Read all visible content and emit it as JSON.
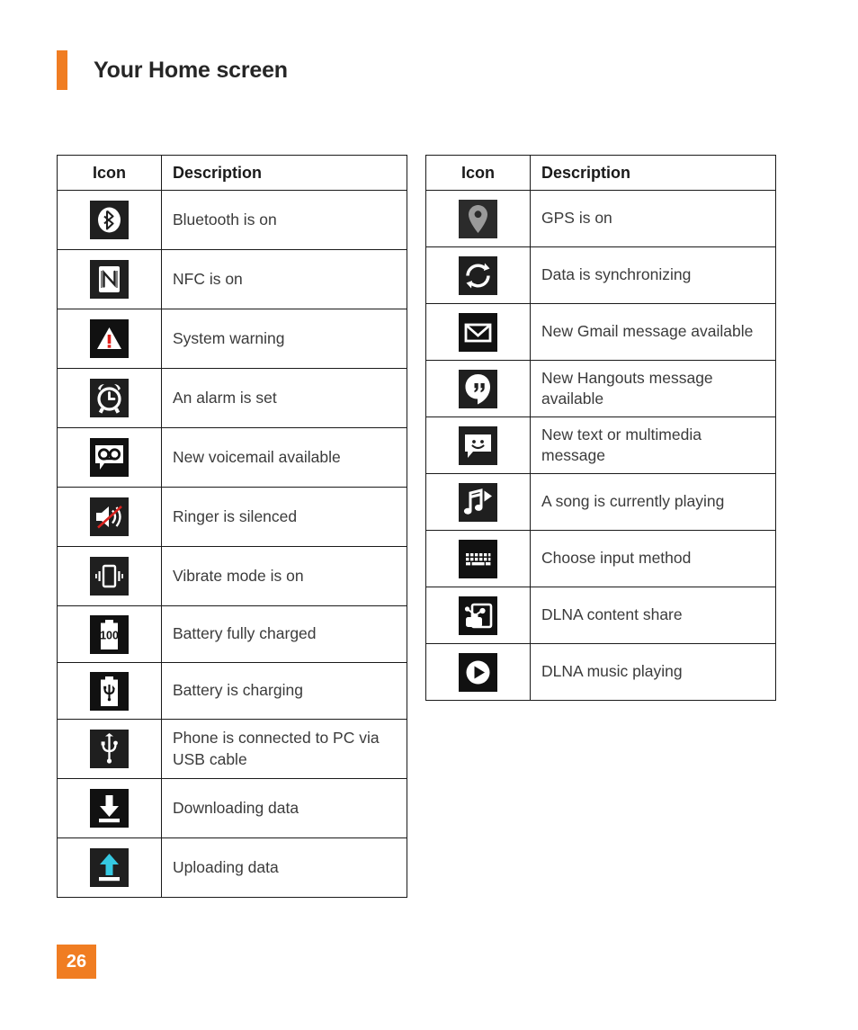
{
  "page": {
    "title": "Your Home screen",
    "number": "26",
    "accent_color": "#f07d22",
    "text_color": "#3b3b3b",
    "border_color": "#1a1a1a"
  },
  "tables": [
    {
      "id": "left",
      "headers": {
        "icon": "Icon",
        "description": "Description"
      },
      "rows": [
        {
          "icon": "bluetooth-icon",
          "description": "Bluetooth is on"
        },
        {
          "icon": "nfc-icon",
          "description": "NFC is on"
        },
        {
          "icon": "warning-icon",
          "description": "System warning"
        },
        {
          "icon": "alarm-clock-icon",
          "description": "An alarm is set"
        },
        {
          "icon": "voicemail-icon",
          "description": "New voicemail available"
        },
        {
          "icon": "mute-speaker-icon",
          "description": "Ringer is silenced"
        },
        {
          "icon": "vibrate-icon",
          "description": "Vibrate mode is on"
        },
        {
          "icon": "battery-full-icon",
          "description": "Battery fully charged"
        },
        {
          "icon": "battery-charging-icon",
          "description": "Battery is charging"
        },
        {
          "icon": "usb-icon",
          "description": "Phone is connected to PC via USB cable"
        },
        {
          "icon": "download-icon",
          "description": "Downloading data"
        },
        {
          "icon": "upload-icon",
          "description": "Uploading data"
        }
      ]
    },
    {
      "id": "right",
      "headers": {
        "icon": "Icon",
        "description": "Description"
      },
      "rows": [
        {
          "icon": "gps-pin-icon",
          "description": "GPS is on"
        },
        {
          "icon": "sync-icon",
          "description": "Data is synchronizing"
        },
        {
          "icon": "gmail-icon",
          "description": "New Gmail message available"
        },
        {
          "icon": "hangouts-icon",
          "description": "New Hangouts message available"
        },
        {
          "icon": "sms-icon",
          "description": "New text or multimedia message"
        },
        {
          "icon": "music-note-icon",
          "description": "A song is currently playing"
        },
        {
          "icon": "keyboard-icon",
          "description": "Choose input method"
        },
        {
          "icon": "dlna-share-icon",
          "description": "DLNA content share"
        },
        {
          "icon": "play-circle-icon",
          "description": "DLNA music playing"
        }
      ]
    }
  ]
}
